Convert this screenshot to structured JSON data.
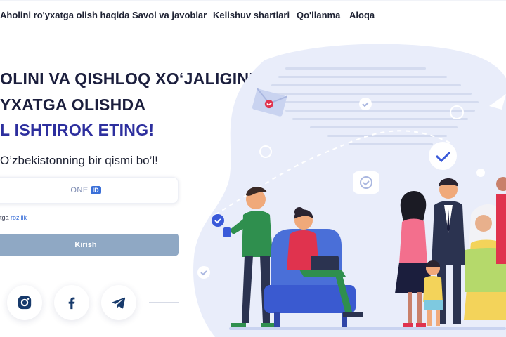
{
  "nav": {
    "items": [
      "Aholini ro'yxatga olish haqida",
      "Savol va javoblar",
      "Kelishuv shartlari",
      "Qo'llanma",
      "Aloqa"
    ]
  },
  "hero": {
    "line1": "OLINI VA QISHLOQ XO‘JALIGINI",
    "line2": "YXATGA OLISHDA",
    "line3": "L ISHTIROK ETING!",
    "subtitle": "O’zbekistonning bir qismi bo’l!"
  },
  "login": {
    "oneid_text": "ONE",
    "oneid_badge": "ID",
    "consent_prefix": "tga ",
    "consent_link": "rozilik",
    "submit_label": "Kirish"
  },
  "social": [
    {
      "name": "instagram",
      "icon": "instagram-icon"
    },
    {
      "name": "facebook",
      "icon": "facebook-icon"
    },
    {
      "name": "telegram",
      "icon": "telegram-icon"
    }
  ],
  "colors": {
    "accent": "#2d2f9e",
    "heading": "#1b1e3d",
    "button": "#8fa8c4",
    "link": "#3a6fd8",
    "blob": "#e9edfa"
  }
}
